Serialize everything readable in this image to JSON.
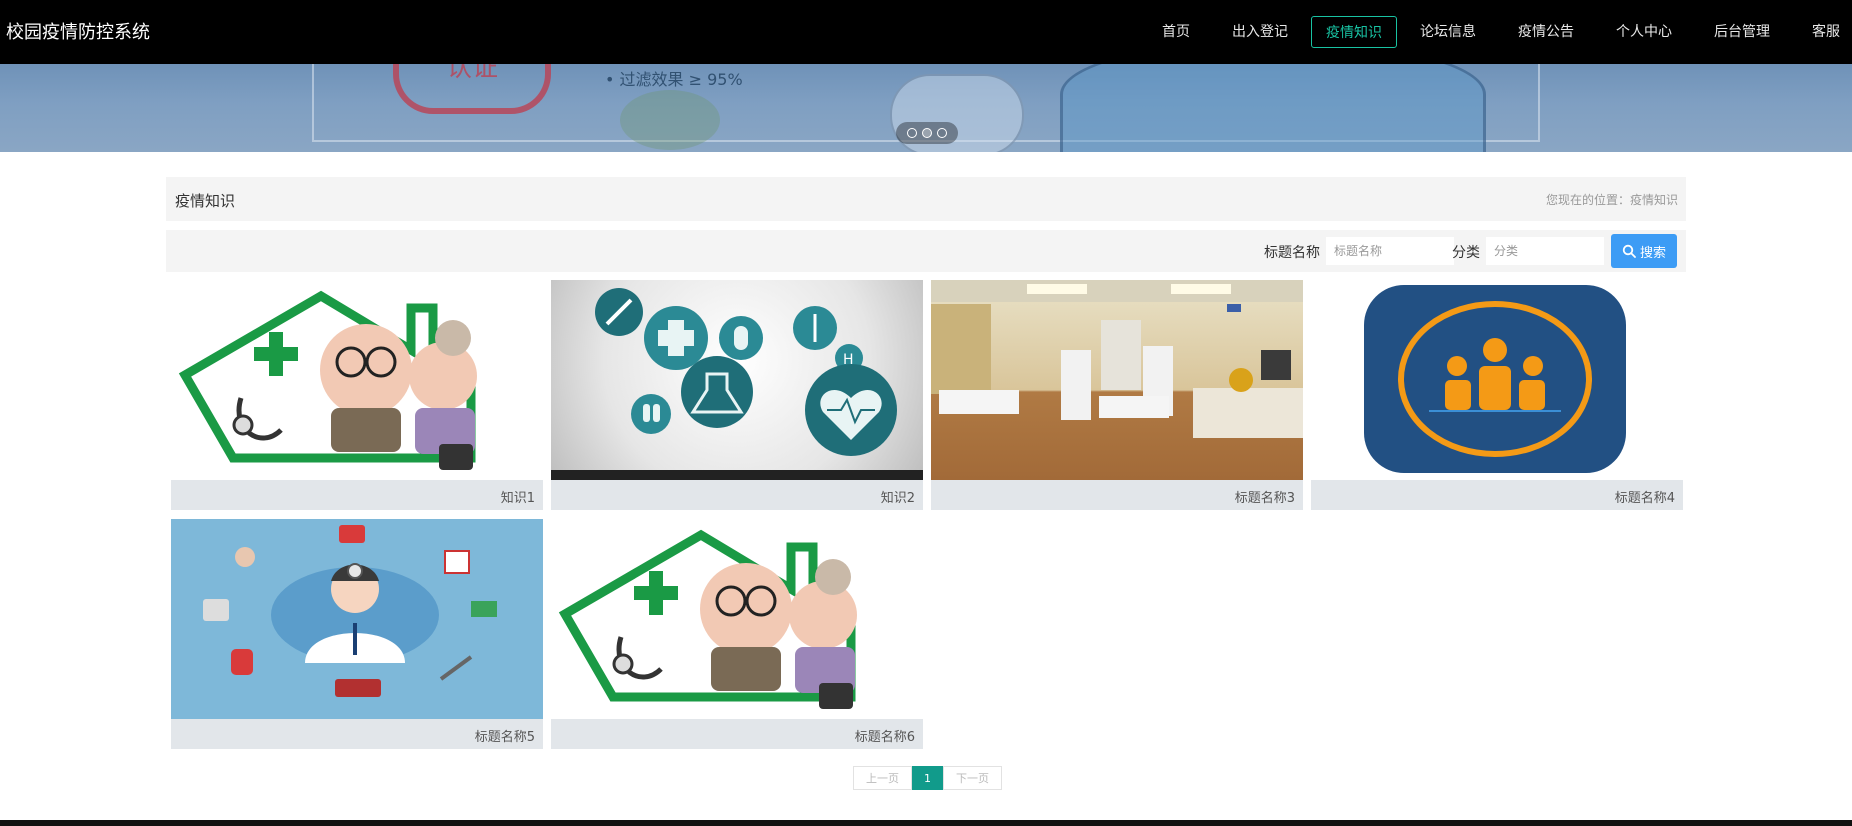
{
  "app": {
    "title": "校园疫情防控系统"
  },
  "nav": {
    "items": [
      "首页",
      "出入登记",
      "疫情知识",
      "论坛信息",
      "疫情公告",
      "个人中心",
      "后台管理",
      "客服"
    ],
    "active_index": 2
  },
  "banner": {
    "cert_text": "认证",
    "line_text": "• 过滤效果 ≥ 95%",
    "slide_count": 3,
    "active_slide": 2
  },
  "page": {
    "title": "疫情知识",
    "breadcrumb": "您现在的位置：疫情知识"
  },
  "search": {
    "title_label": "标题名称",
    "title_placeholder": "标题名称",
    "category_label": "分类",
    "category_placeholder": "分类",
    "button_label": "搜索"
  },
  "cards": [
    {
      "title": "知识1",
      "image": "elderly-couple-doctor-home"
    },
    {
      "title": "知识2",
      "image": "medical-icons-heart"
    },
    {
      "title": "标题名称3",
      "image": "hospital-ward"
    },
    {
      "title": "标题名称4",
      "image": "people-group-icon"
    },
    {
      "title": "标题名称5",
      "image": "doctor-illustration"
    },
    {
      "title": "标题名称6",
      "image": "elderly-couple-doctor-home"
    }
  ],
  "pagination": {
    "prev": "上一页",
    "current": "1",
    "next": "下一页"
  },
  "colors": {
    "accent": "#19c3a3",
    "search_button": "#3d9cf5",
    "page_active": "#119b8b"
  }
}
